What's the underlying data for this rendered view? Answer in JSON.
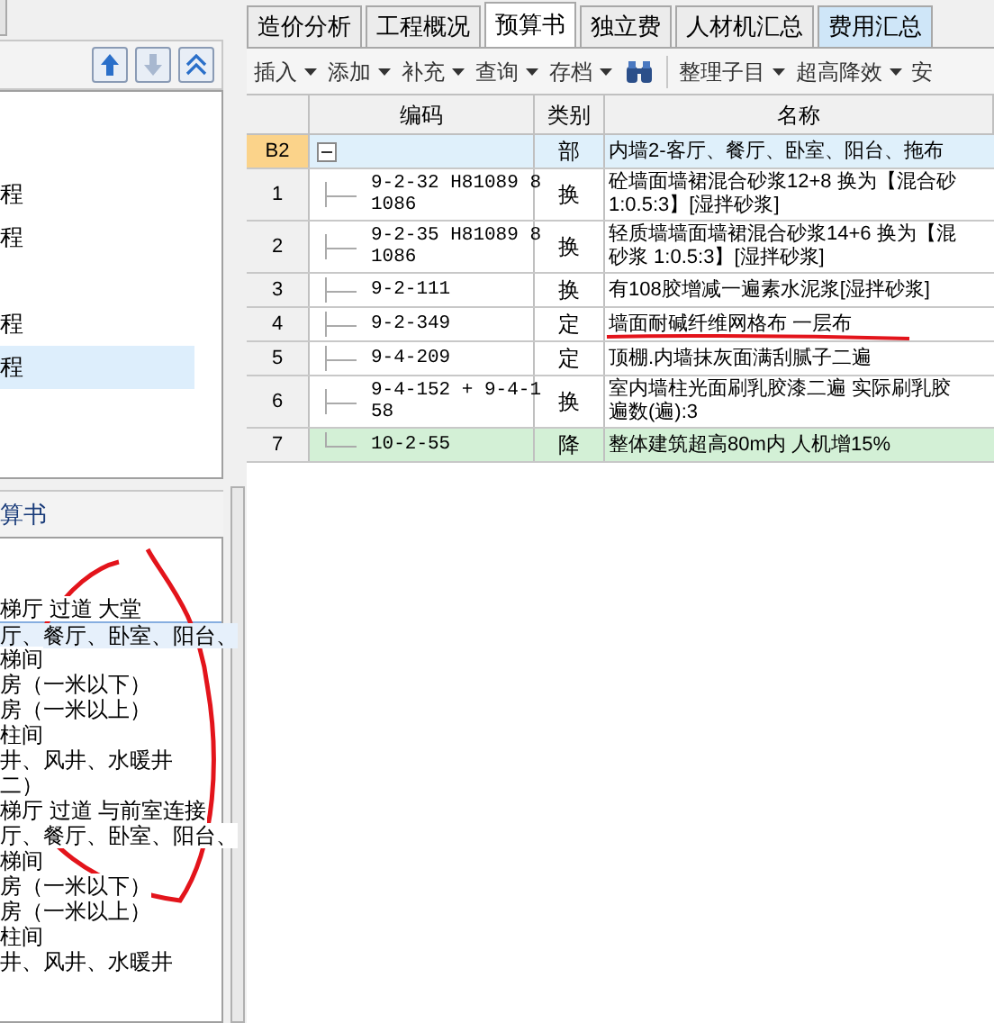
{
  "left_panel": {
    "tree_items": [
      {
        "label": "程",
        "selected": false
      },
      {
        "label": "程",
        "selected": false
      },
      {
        "label": "程",
        "selected": false
      },
      {
        "label": "程",
        "selected": true
      }
    ],
    "list_title": "算书",
    "circled": true,
    "list_items": [
      {
        "label": "梯厅 过道 大堂",
        "selected": false
      },
      {
        "label": "厅、餐厅、卧室、阳台、",
        "selected": true
      },
      {
        "label": "梯间",
        "selected": false
      },
      {
        "label": "房（一米以下）",
        "selected": false
      },
      {
        "label": "房（一米以上）",
        "selected": false
      },
      {
        "label": "柱间",
        "selected": false
      },
      {
        "label": "井、风井、水暖井",
        "selected": false
      },
      {
        "label": "二）",
        "selected": false
      },
      {
        "label": "梯厅 过道 与前室连接",
        "selected": false
      },
      {
        "label": "厅、餐厅、卧室、阳台、",
        "selected": false
      },
      {
        "label": "梯间",
        "selected": false
      },
      {
        "label": "房（一米以下）",
        "selected": false
      },
      {
        "label": "房（一米以上）",
        "selected": false
      },
      {
        "label": "柱间",
        "selected": false
      },
      {
        "label": "井、风井、水暖井",
        "selected": false
      }
    ]
  },
  "tabs": [
    {
      "label": "造价分析",
      "selected": false,
      "kind": "plain"
    },
    {
      "label": "工程概况",
      "selected": false,
      "kind": "plain"
    },
    {
      "label": "预算书",
      "selected": true,
      "kind": "plain"
    },
    {
      "label": "独立费",
      "selected": false,
      "kind": "plain"
    },
    {
      "label": "人材机汇总",
      "selected": false,
      "kind": "plain"
    },
    {
      "label": "费用汇总",
      "selected": false,
      "kind": "highlighted"
    }
  ],
  "toolbar": [
    {
      "kind": "menu",
      "label": "插入"
    },
    {
      "kind": "menu",
      "label": "添加"
    },
    {
      "kind": "menu",
      "label": "补充"
    },
    {
      "kind": "menu",
      "label": "查询"
    },
    {
      "kind": "menu",
      "label": "存档"
    },
    {
      "kind": "find"
    },
    {
      "kind": "divider"
    },
    {
      "kind": "menu",
      "label": "整理子目"
    },
    {
      "kind": "menu",
      "label": "超高降效"
    },
    {
      "kind": "text",
      "label": "安"
    }
  ],
  "table": {
    "columns": [
      "编码",
      "类别",
      "名称"
    ],
    "rows": [
      {
        "number": "B2",
        "kind": "section",
        "expanded": true,
        "code": [],
        "type": "部",
        "underlined": false,
        "name": [
          "内墙2-客厅、餐厅、卧室、阳台、拖布"
        ]
      },
      {
        "number": "1",
        "kind": "item",
        "code": [
          "9-2-32 H81089 8",
          "1086"
        ],
        "type": "换",
        "underlined": false,
        "name": [
          "砼墙面墙裙混合砂浆12+8 换为【混合砂",
          "1:0.5:3】[湿拌砂浆]"
        ]
      },
      {
        "number": "2",
        "kind": "item",
        "code": [
          "9-2-35 H81089 8",
          "1086"
        ],
        "type": "换",
        "underlined": false,
        "name": [
          "轻质墙墙面墙裙混合砂浆14+6 换为【混",
          "砂浆 1:0.5:3】[湿拌砂浆]"
        ]
      },
      {
        "number": "3",
        "kind": "item",
        "code": [
          "9-2-111"
        ],
        "type": "换",
        "underlined": false,
        "name": [
          "有108胶增减一遍素水泥浆[湿拌砂浆]"
        ]
      },
      {
        "number": "4",
        "kind": "item",
        "code": [
          "9-2-349"
        ],
        "type": "定",
        "underlined": true,
        "name": [
          "墙面耐碱纤维网格布 一层布"
        ]
      },
      {
        "number": "5",
        "kind": "item",
        "code": [
          "9-4-209"
        ],
        "type": "定",
        "underlined": false,
        "name": [
          "顶棚.内墙抹灰面满刮腻子二遍"
        ]
      },
      {
        "number": "6",
        "kind": "item",
        "code": [
          "9-4-152 + 9-4-1",
          "58"
        ],
        "type": "换",
        "underlined": false,
        "name": [
          "室内墙柱光面刷乳胶漆二遍 实际刷乳胶",
          "遍数(遍):3"
        ]
      },
      {
        "number": "7",
        "kind": "reduction",
        "code": [
          "10-2-55"
        ],
        "type": "降",
        "underlined": false,
        "name": [
          "整体建筑超高80m内 人机增15%"
        ]
      }
    ]
  }
}
